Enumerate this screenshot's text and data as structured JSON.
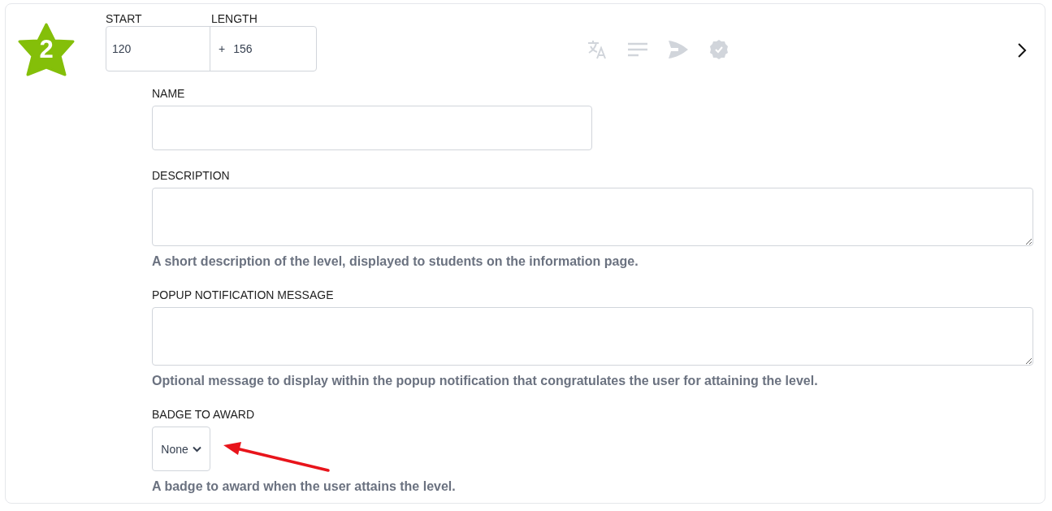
{
  "level": {
    "number": "2"
  },
  "range": {
    "start_label": "START",
    "start_value": "120",
    "length_label": "LENGTH",
    "length_prefix": "+",
    "length_value": "156"
  },
  "fields": [
    {
      "kind": "input",
      "label": "NAME"
    },
    {
      "kind": "textarea",
      "label": "DESCRIPTION",
      "help": "A short description of the level, displayed to students on the information page."
    },
    {
      "kind": "textarea",
      "label": "POPUP NOTIFICATION MESSAGE",
      "help": "Optional message to display within the popup notification that congratulates the user for attaining the level."
    },
    {
      "kind": "select",
      "label": "BADGE TO AWARD",
      "value": "None",
      "help": "A badge to award when the user attains the level."
    }
  ]
}
